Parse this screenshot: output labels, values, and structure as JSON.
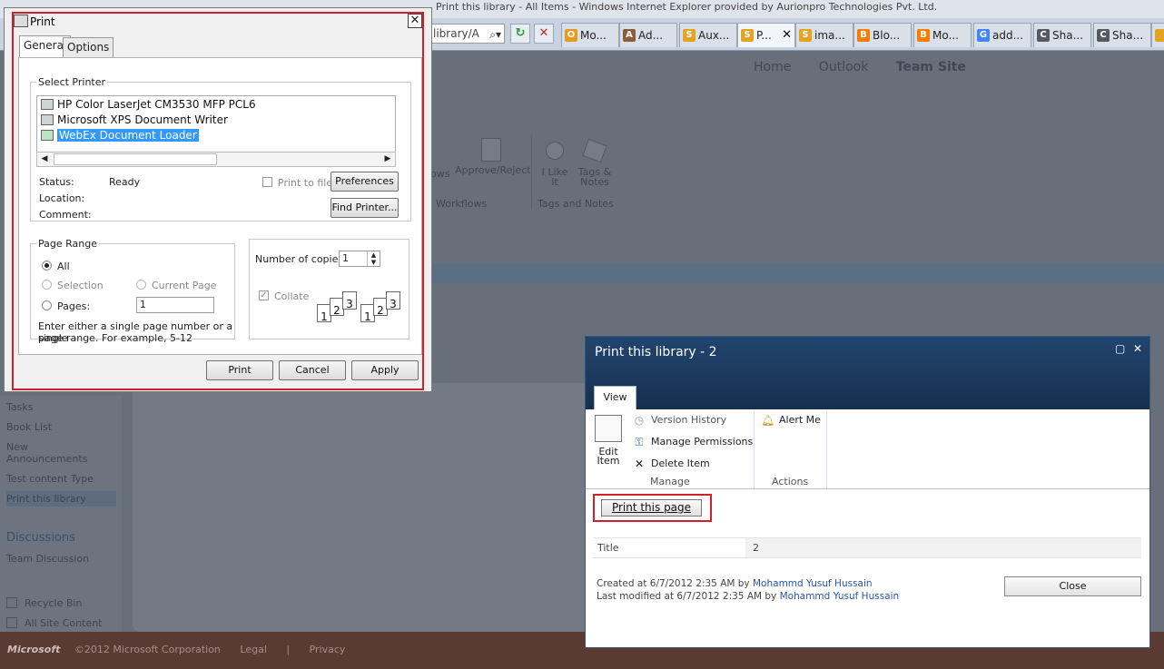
{
  "browser": {
    "title_text": "Print this library - All Items - Windows Internet Explorer provided by Aurionpro Technologies Pvt. Ltd.",
    "address_text": "library/A",
    "tabs": [
      {
        "label": "Mo...",
        "favicon": "O",
        "color": "#e79a1b"
      },
      {
        "label": "Ad...",
        "favicon": "A",
        "color": "#8b5d3b"
      },
      {
        "label": "Aux...",
        "favicon": "S",
        "color": "#e6a321"
      },
      {
        "label": "P...",
        "favicon": "S",
        "color": "#e6a321",
        "active": true
      },
      {
        "label": "ima...",
        "favicon": "S",
        "color": "#e6a321"
      },
      {
        "label": "Blo...",
        "favicon": "B",
        "color": "#f57d00"
      },
      {
        "label": "Mo...",
        "favicon": "B",
        "color": "#f57d00"
      },
      {
        "label": "add...",
        "favicon": "G",
        "color": "#4285f4"
      },
      {
        "label": "Sha...",
        "favicon": "C",
        "color": "#555a63"
      },
      {
        "label": "Sha...",
        "favicon": "C",
        "color": "#555a63"
      }
    ]
  },
  "sharepoint": {
    "topnav": [
      "Home",
      "Outlook",
      "Team Site"
    ],
    "ribbon": {
      "items": [
        "ows",
        "Approve/Reject",
        "I Like It",
        "Tags & Notes"
      ],
      "groups": [
        "Workflows",
        "Tags and Notes"
      ]
    },
    "leftnav": {
      "items": [
        "Tasks",
        "Book List",
        "New Announcements",
        "Test content Type",
        "Print this library"
      ],
      "selected": "Print this library",
      "discussions_header": "Discussions",
      "discussions_items": [
        "Team Discussion"
      ],
      "bottom_items": [
        "Recycle Bin",
        "All Site Content"
      ]
    },
    "footer": {
      "logo": "Microsoft",
      "copyright": "©2012 Microsoft Corporation",
      "legal": "Legal",
      "separator": "|",
      "privacy": "Privacy"
    }
  },
  "print_dialog": {
    "title": "Print",
    "tabs": [
      "General",
      "Options"
    ],
    "select_printer_label": "Select Printer",
    "printers": [
      {
        "name": "HP Color LaserJet CM3530 MFP PCL6",
        "selected": false
      },
      {
        "name": "Microsoft XPS Document Writer",
        "selected": false
      },
      {
        "name": "WebEx Document Loader",
        "selected": true
      }
    ],
    "status_label": "Status:",
    "status_value": "Ready",
    "location_label": "Location:",
    "comment_label": "Comment:",
    "print_to_file": "Print to file",
    "preferences": "Preferences",
    "find_printer": "Find Printer...",
    "page_range_label": "Page Range",
    "range_all": "All",
    "range_selection": "Selection",
    "range_current_page": "Current Page",
    "range_pages": "Pages:",
    "pages_value": "1",
    "range_hint_1": "Enter either a single page number or a single",
    "range_hint_2": "page range.  For example, 5-12",
    "copies_label": "Number of copies:",
    "copies_value": "1",
    "collate": "Collate",
    "collate_pages": [
      "1",
      "2",
      "3"
    ],
    "buttons": {
      "print": "Print",
      "cancel": "Cancel",
      "apply": "Apply"
    }
  },
  "sp_modal": {
    "title": "Print this library - 2",
    "tab": "View",
    "edit_item_1": "Edit",
    "edit_item_2": "Item",
    "version_history": "Version History",
    "manage_permissions": "Manage Permissions",
    "delete_item": "Delete Item",
    "alert_me": "Alert Me",
    "group_manage": "Manage",
    "group_actions": "Actions",
    "print_page": "Print this page",
    "title_label": "Title",
    "title_value": "2",
    "created_prefix": "Created at 6/7/2012 2:35 AM  by",
    "modified_prefix": "Last modified at 6/7/2012 2:35 AM  by",
    "author": "Mohammd Yusuf Hussain",
    "close": "Close"
  }
}
